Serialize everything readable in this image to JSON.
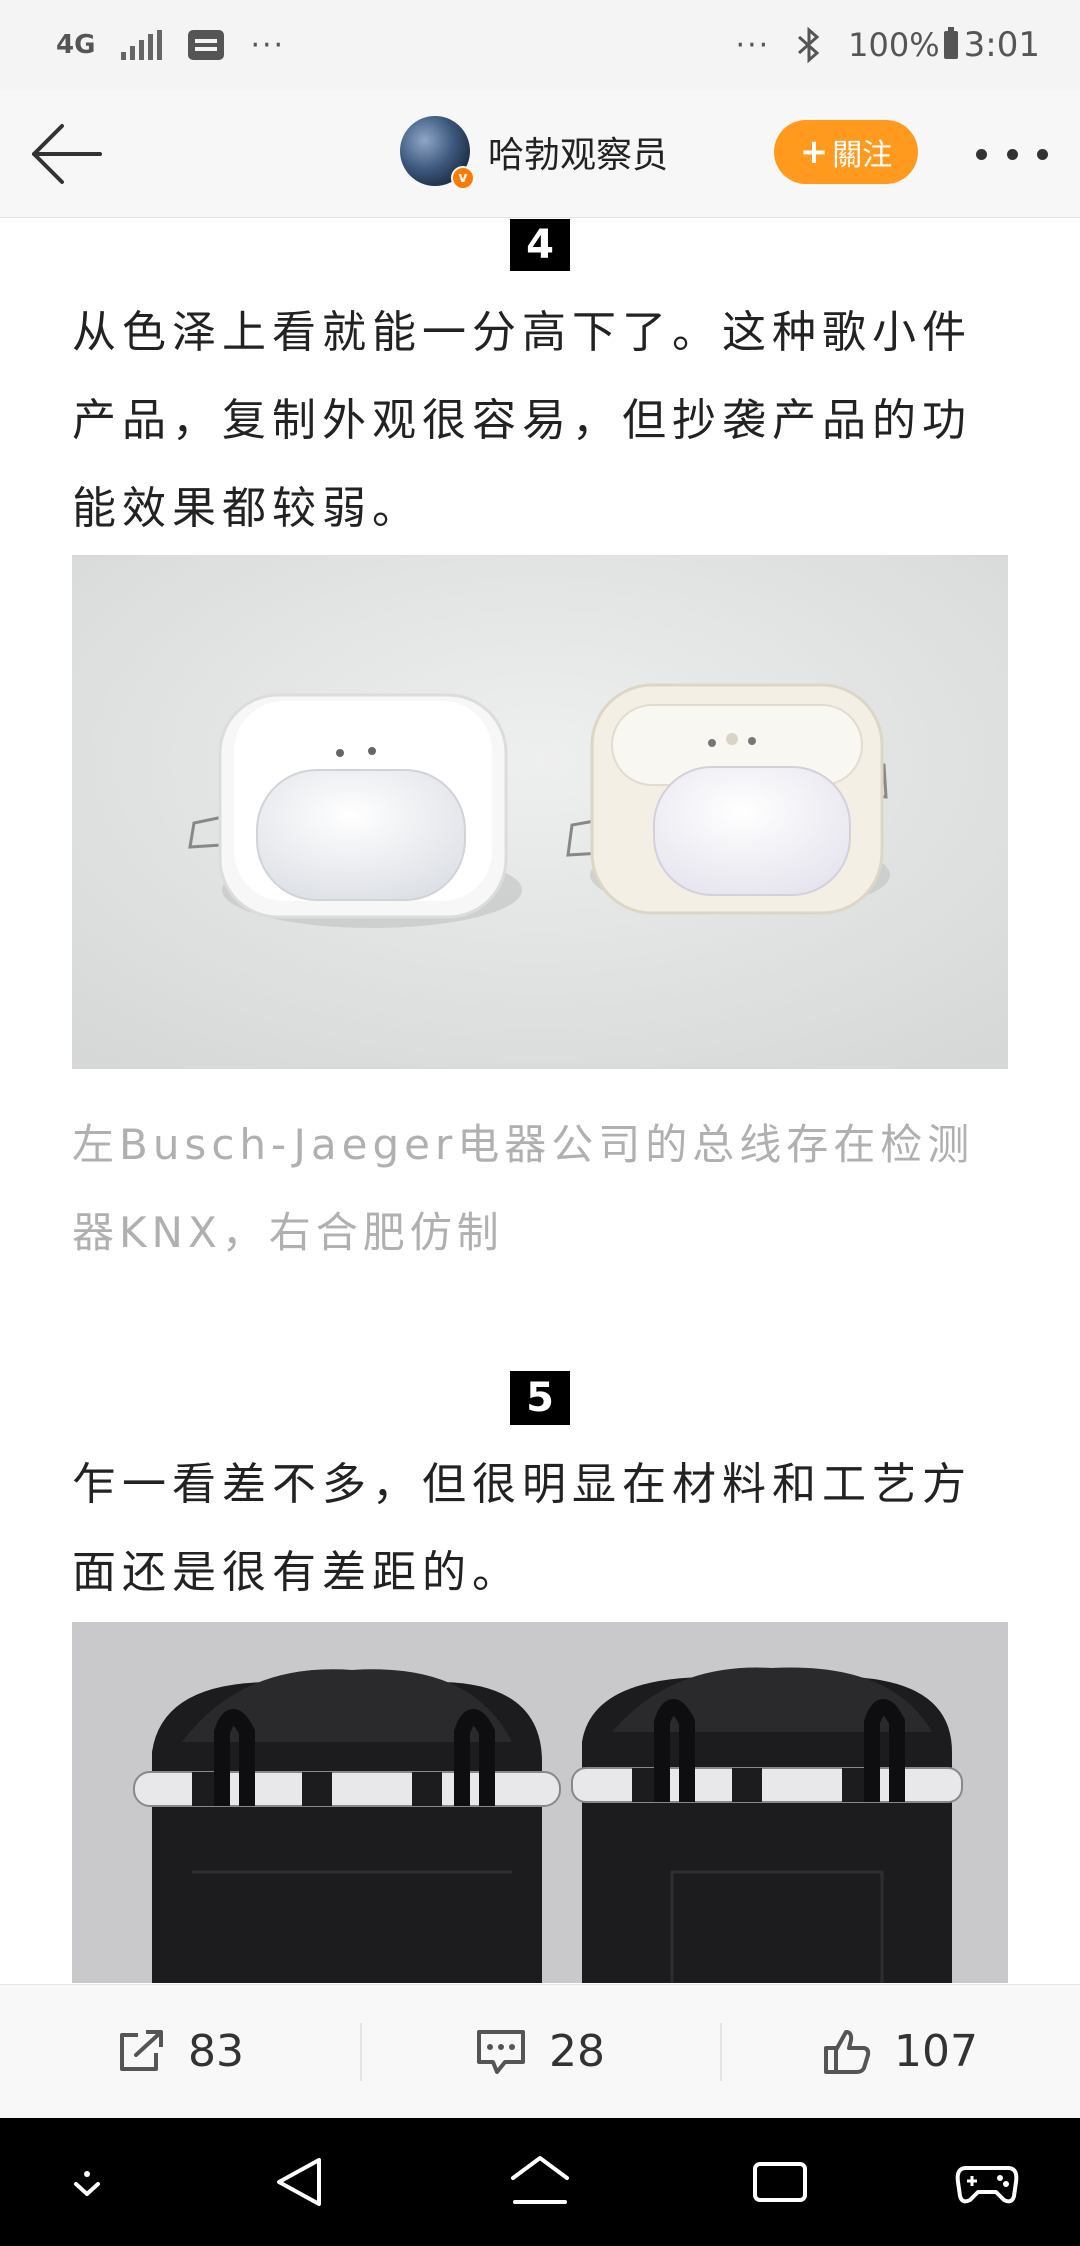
{
  "status_bar": {
    "network": "4G",
    "more": "···",
    "bluetooth": "✱",
    "battery": "100%",
    "time": "3:01"
  },
  "header": {
    "author": "哈勃观察员",
    "follow_label": "關注",
    "follow_plus": "+",
    "verified": "v"
  },
  "article": {
    "sections": [
      {
        "number": "4",
        "text": "从色泽上看就能一分高下了。这种歌小件产品，复制外观很容易，但抄袭产品的功能效果都较弱。",
        "caption": "左Busch-Jaeger电器公司的总线存在检测器KNX，右合肥仿制"
      },
      {
        "number": "5",
        "text": "乍一看差不多，但很明显在材料和工艺方面还是很有差距的。"
      }
    ]
  },
  "actions": {
    "share_count": "83",
    "comment_count": "28",
    "like_count": "107"
  },
  "colors": {
    "accent": "#ff9a1e",
    "caption_gray": "#b0b0b0",
    "badge_black": "#000000"
  }
}
